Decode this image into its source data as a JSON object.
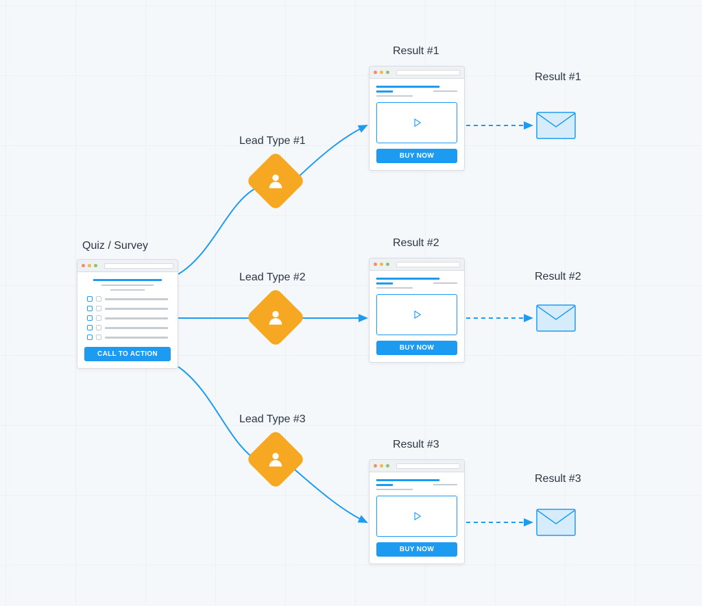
{
  "quiz": {
    "title": "Quiz / Survey",
    "cta": "CALL TO ACTION"
  },
  "leads": [
    {
      "label": "Lead Type #1"
    },
    {
      "label": "Lead Type #2"
    },
    {
      "label": "Lead Type #3"
    }
  ],
  "results": [
    {
      "page_label": "Result #1",
      "email_label": "Result #1",
      "button": "BUY NOW"
    },
    {
      "page_label": "Result #2",
      "email_label": "Result #2",
      "button": "BUY NOW"
    },
    {
      "page_label": "Result #3",
      "email_label": "Result #3",
      "button": "BUY NOW"
    }
  ],
  "colors": {
    "accent": "#1d9bf0",
    "diamond": "#f7a823",
    "bg": "#f5f8fb"
  }
}
